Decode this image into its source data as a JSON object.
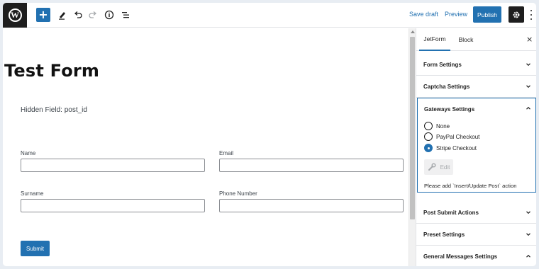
{
  "topbar": {
    "add_label": "+",
    "save_draft": "Save draft",
    "preview": "Preview",
    "publish": "Publish",
    "icons": [
      "wordpress-logo",
      "plus-icon",
      "pencil-icon",
      "undo-icon",
      "redo-icon",
      "info-icon",
      "list-view-icon",
      "gear-icon",
      "kebab-menu-icon"
    ]
  },
  "canvas": {
    "title": "Test Form",
    "hidden_field": "Hidden Field: post_id",
    "fields": [
      {
        "label": "Name",
        "value": ""
      },
      {
        "label": "Email",
        "value": ""
      },
      {
        "label": "Surname",
        "value": ""
      },
      {
        "label": "Phone Number",
        "value": ""
      }
    ],
    "submit": "Submit"
  },
  "sidebar": {
    "tabs": [
      "JetForm",
      "Block"
    ],
    "active_tab": "JetForm",
    "close": "×",
    "panels": {
      "form_settings": "Form Settings",
      "captcha_settings": "Captcha Settings",
      "gateways_settings": "Gateways Settings",
      "post_submit_actions": "Post Submit Actions",
      "preset_settings": "Preset Settings",
      "general_messages": "General Messages Settings"
    },
    "gateways": {
      "options": [
        "None",
        "PayPal Checkout",
        "Stripe Checkout"
      ],
      "selected": "Stripe Checkout",
      "edit": "Edit",
      "note": "Please add `Insert/Update Post` action"
    }
  },
  "colors": {
    "accent": "#2271b1",
    "dark": "#1e1e1e",
    "border": "#8c8f94"
  }
}
